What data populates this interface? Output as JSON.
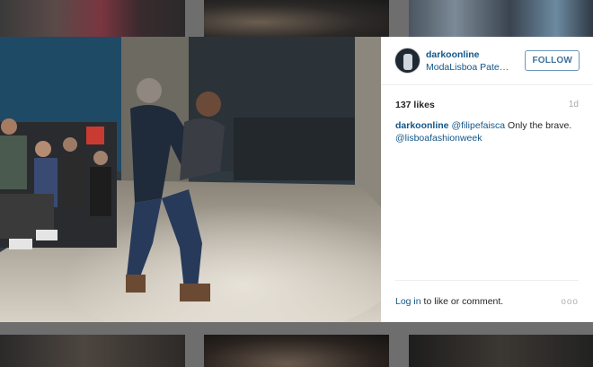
{
  "post": {
    "username": "darkoonline",
    "location": "ModaLisboa Pateo ...",
    "follow_label": "FOLLOW",
    "likes": "137 likes",
    "age": "1d",
    "caption": {
      "username": "darkoonline",
      "mention1": "@filipefaisca",
      "text": " Only the brave.",
      "mention2": "@lisboafashionweek"
    },
    "login_link": "Log in",
    "login_text": " to like or comment.",
    "more_label": "ooo"
  },
  "icons": {
    "more": "more-options-icon"
  }
}
